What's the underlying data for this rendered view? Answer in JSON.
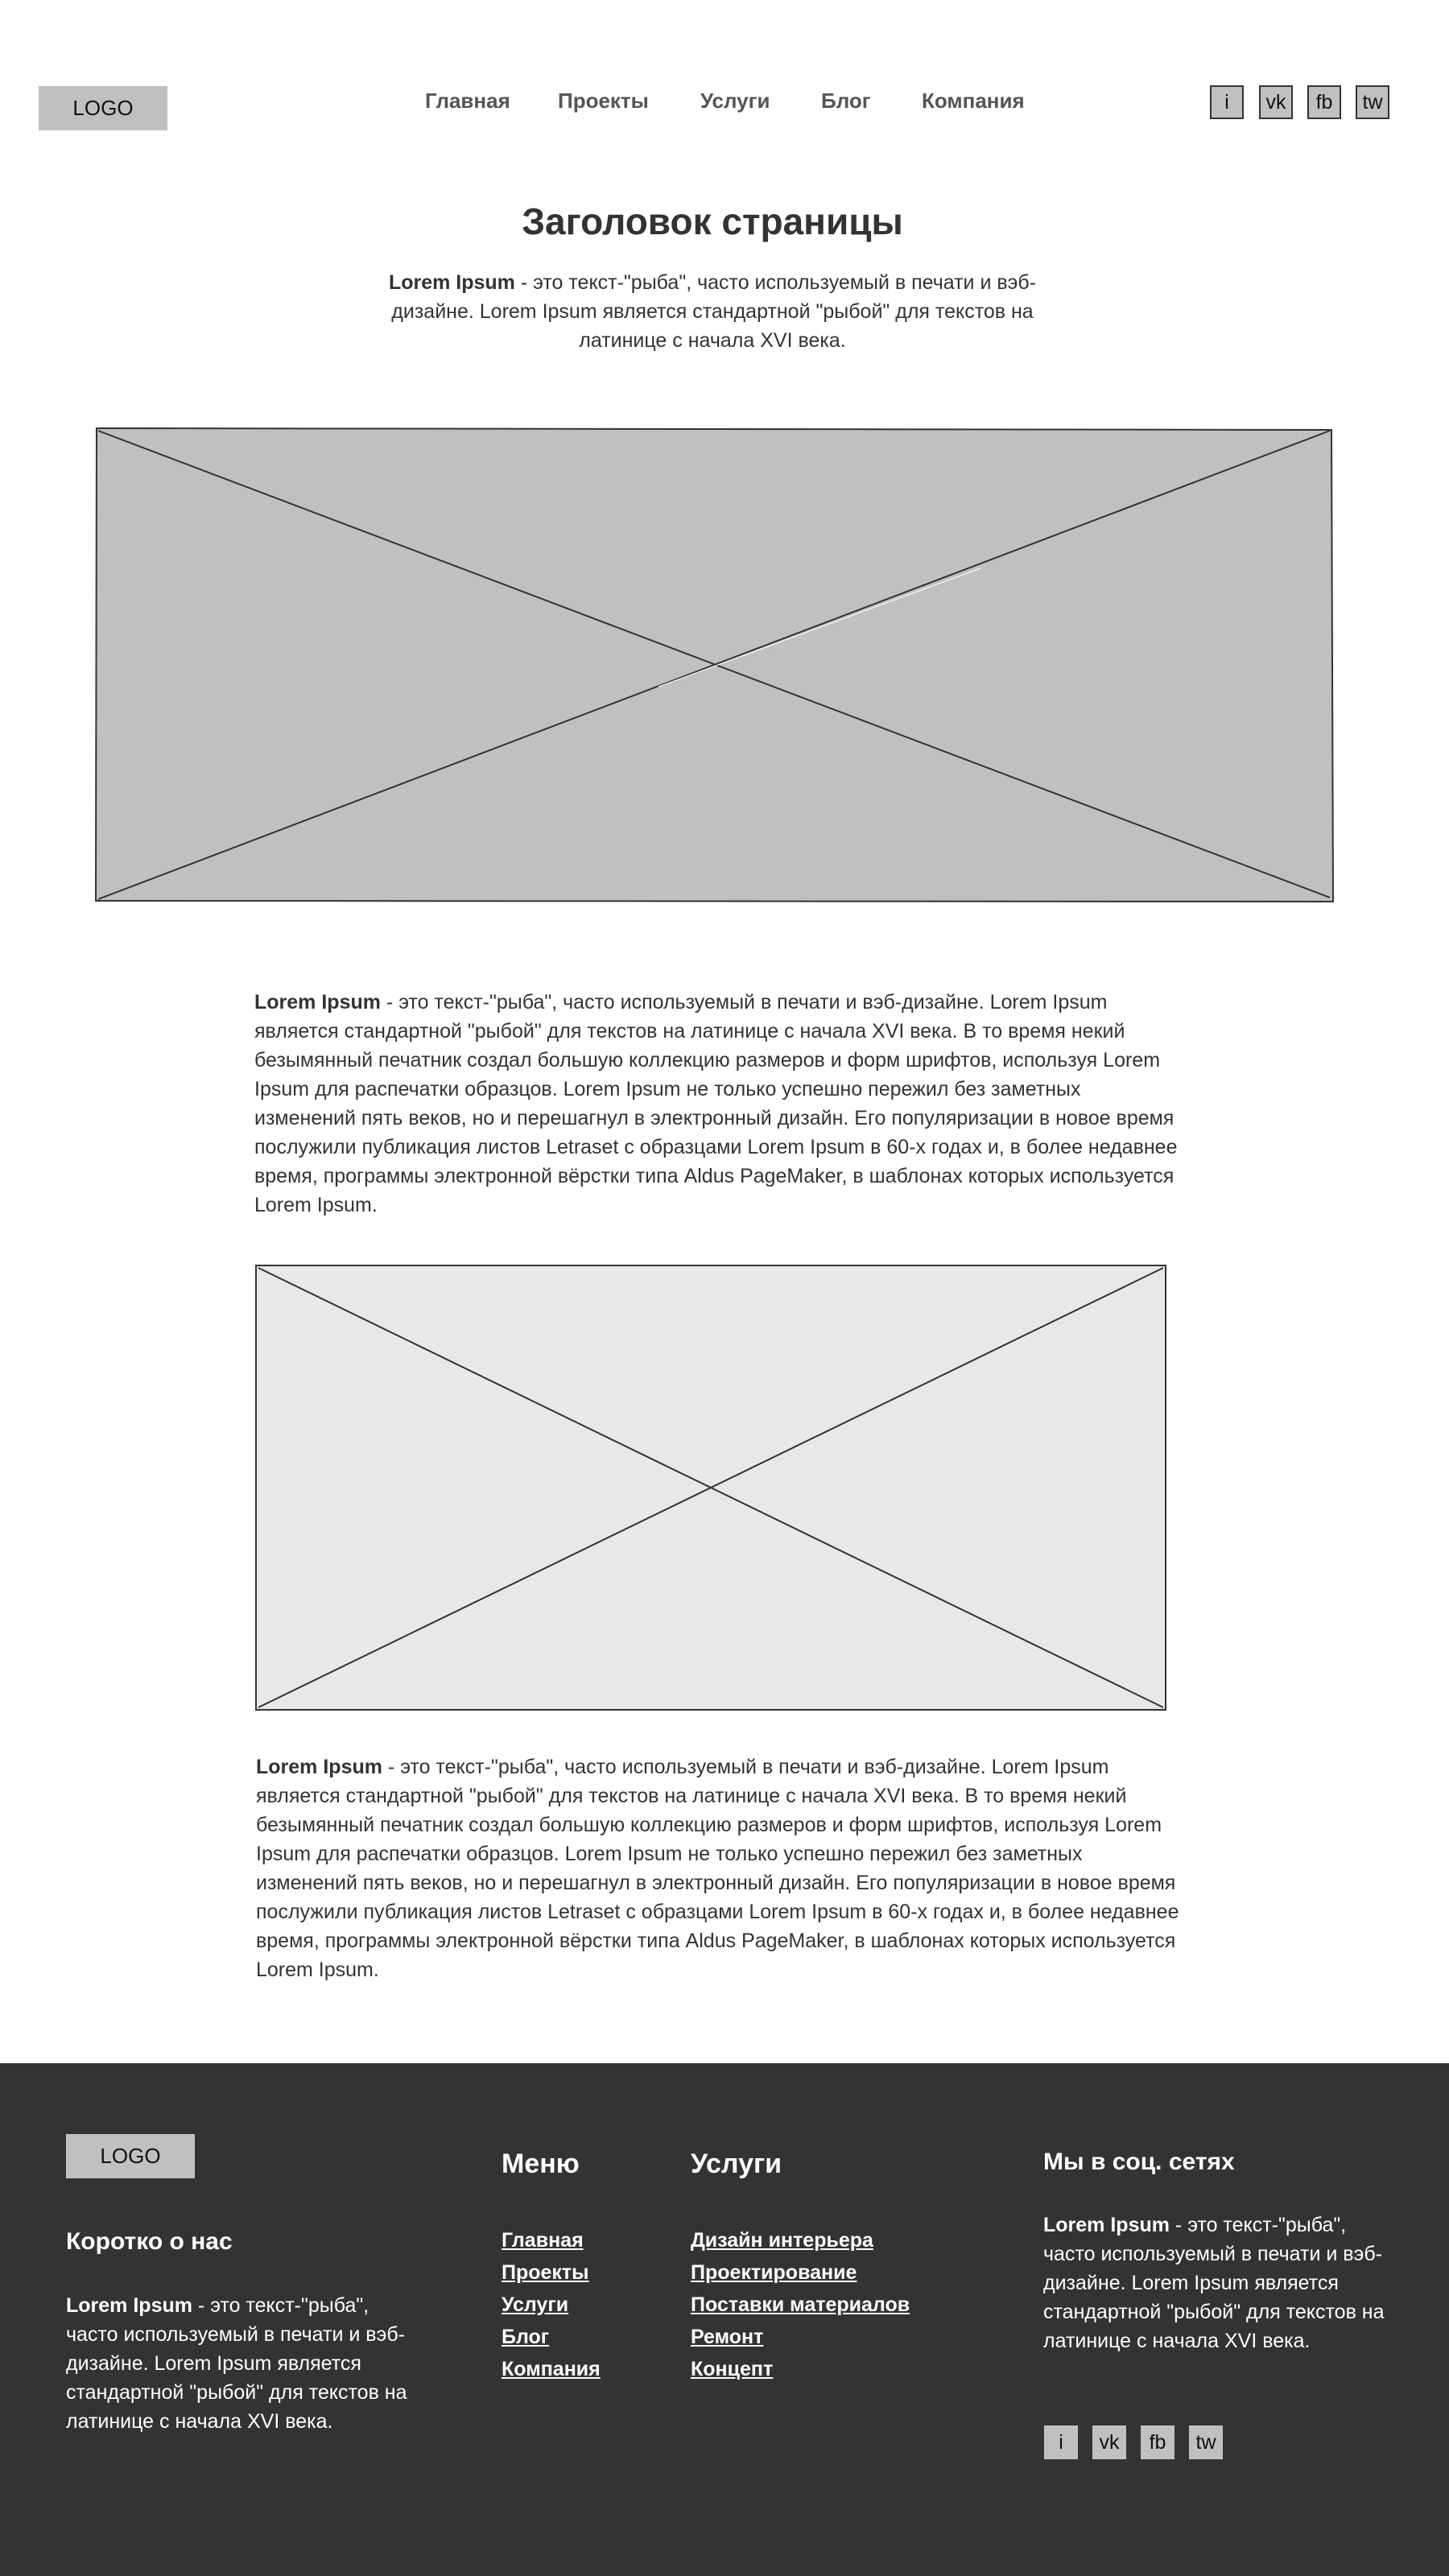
{
  "header": {
    "logo": "LOGO",
    "nav": [
      "Главная",
      "Проекты",
      "Услуги",
      "Блог",
      "Компания"
    ],
    "social": [
      "i",
      "vk",
      "fb",
      "tw"
    ]
  },
  "main": {
    "title": "Заголовок страницы",
    "intro_bold": "Lorem Ipsum",
    "intro_rest": " - это текст-\"рыба\", часто используемый в печати и вэб-дизайне. Lorem Ipsum является стандартной \"рыбой\" для текстов на латинице с начала XVI века.",
    "para1_bold": "Lorem Ipsum",
    "para1_rest": " - это текст-\"рыба\", часто используемый в печати и вэб-дизайне. Lorem Ipsum является стандартной \"рыбой\" для текстов на латинице с начала XVI века. В то время некий безымянный печатник создал большую коллекцию размеров и форм шрифтов, используя Lorem Ipsum для распечатки образцов. Lorem Ipsum не только успешно пережил без заметных изменений пять веков, но и перешагнул в электронный дизайн. Его популяризации в новое время послужили публикация листов Letraset с образцами Lorem Ipsum в 60-х годах и, в более недавнее время, программы электронной вёрстки типа Aldus PageMaker, в шаблонах которых используется Lorem Ipsum.",
    "para2_bold": "Lorem Ipsum",
    "para2_rest": " - это текст-\"рыба\", часто используемый в печати и вэб-дизайне. Lorem Ipsum является стандартной \"рыбой\" для текстов на латинице с начала XVI века. В то время некий безымянный печатник создал большую коллекцию размеров и форм шрифтов, используя Lorem Ipsum для распечатки образцов. Lorem Ipsum не только успешно пережил без заметных изменений пять веков, но и перешагнул в электронный дизайн. Его популяризации в новое время послужили публикация листов Letraset с образцами Lorem Ipsum в 60-х годах и, в более недавнее время, программы электронной вёрстки типа Aldus PageMaker, в шаблонах которых используется Lorem Ipsum."
  },
  "footer": {
    "logo": "LOGO",
    "about_title": "Коротко о нас",
    "about_bold": "Lorem Ipsum",
    "about_rest": " - это текст-\"рыба\", часто используемый в печати и вэб-дизайне. Lorem Ipsum является стандартной \"рыбой\" для текстов на латинице с начала XVI века.",
    "menu_title": "Меню",
    "menu_links": [
      "Главная",
      "Проекты",
      "Услуги",
      "Блог",
      "Компания"
    ],
    "services_title": "Услуги",
    "services_links": [
      "Дизайн интерьера",
      "Проектирование ",
      "Поставки материалов",
      "Ремонт",
      "Концепт"
    ],
    "social_title": "Мы в соц. сетях",
    "social_bold": "Lorem Ipsum",
    "social_rest": " - это текст-\"рыба\", часто используемый в печати и вэб-дизайне. Lorem Ipsum является стандартной \"рыбой\" для текстов на латинице с начала XVI века.",
    "social": [
      "i",
      "vk",
      "fb",
      "tw"
    ]
  },
  "colors": {
    "footer_bg": "#333333",
    "placeholder_dark": "#c0c0c0",
    "placeholder_light": "#e8e8e8",
    "button_gray": "#c0c0c0"
  }
}
